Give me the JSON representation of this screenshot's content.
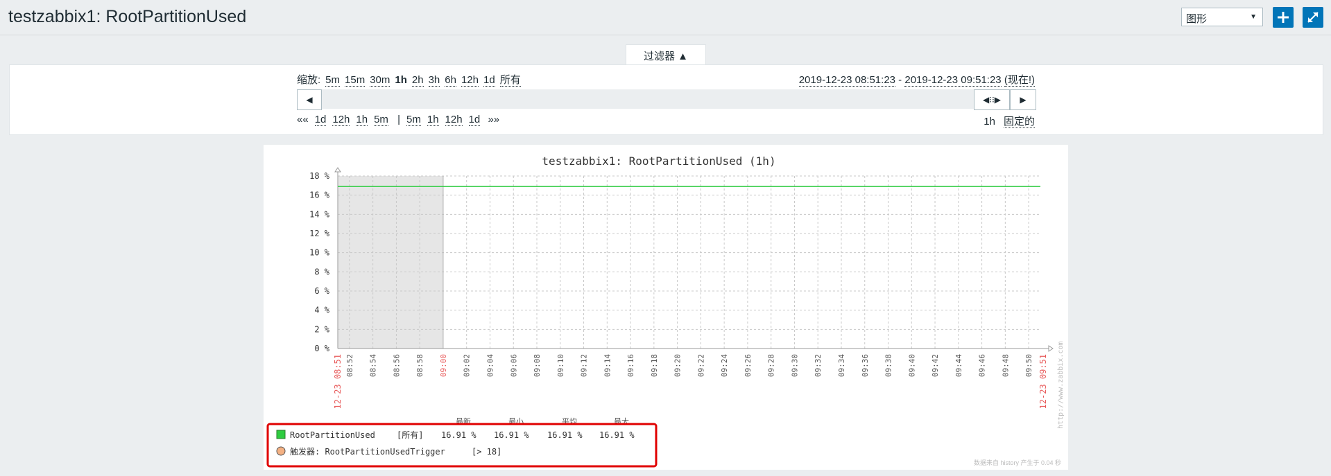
{
  "header": {
    "title": "testzabbix1: RootPartitionUsed",
    "view_select": "图形",
    "add_icon": "plus-icon",
    "fullscreen_icon": "fullscreen-icon"
  },
  "filter": {
    "tab_label": "过滤器",
    "zoom_label": "缩放:",
    "zoom_options": [
      "5m",
      "15m",
      "30m",
      "1h",
      "2h",
      "3h",
      "6h",
      "12h",
      "1d",
      "所有"
    ],
    "zoom_selected": "1h",
    "range_from": "2019-12-23 08:51:23",
    "range_sep": " - ",
    "range_to": "2019-12-23 09:51:23",
    "range_now": "(现在!)",
    "nav_back_prefix": "««",
    "nav_back": [
      "1d",
      "12h",
      "1h",
      "5m"
    ],
    "nav_sep": "|",
    "nav_fwd": [
      "5m",
      "1h",
      "12h",
      "1d"
    ],
    "nav_fwd_suffix": "»»",
    "period": "1h",
    "fixed_label": "固定的"
  },
  "chart_data": {
    "type": "line",
    "title": "testzabbix1: RootPartitionUsed (1h)",
    "ylim": [
      0,
      18
    ],
    "yticks": [
      "0 %",
      "2 %",
      "4 %",
      "6 %",
      "8 %",
      "10 %",
      "12 %",
      "14 %",
      "16 %",
      "18 %"
    ],
    "xticks": [
      "08:52",
      "08:54",
      "08:56",
      "08:58",
      "09:00",
      "09:02",
      "09:04",
      "09:06",
      "09:08",
      "09:10",
      "09:12",
      "09:14",
      "09:16",
      "09:18",
      "09:20",
      "09:22",
      "09:24",
      "09:26",
      "09:28",
      "09:30",
      "09:32",
      "09:34",
      "09:36",
      "09:38",
      "09:40",
      "09:42",
      "09:44",
      "09:46",
      "09:48",
      "09:50"
    ],
    "x_start_label": "12-23 08:51",
    "x_end_label": "12-23 09:51",
    "grid": true,
    "no_data_region": [
      "08:51",
      "09:00"
    ],
    "series": [
      {
        "name": "RootPartitionUsed",
        "color": "#2ecc40",
        "x": [
          "08:51",
          "09:51"
        ],
        "y": [
          16.91,
          16.91
        ]
      }
    ],
    "watermark": "http://www.zabbix.com",
    "footer": "数据来自 history  产生于 0.04 秒"
  },
  "legend": {
    "headers": [
      "最新",
      "最小",
      "平均",
      "最大"
    ],
    "items": [
      {
        "name": "RootPartitionUsed",
        "scope": "[所有]",
        "values": [
          "16.91 %",
          "16.91 %",
          "16.91 %",
          "16.91 %"
        ],
        "color": "#2ecc40"
      },
      {
        "name": "触发器: RootPartitionUsedTrigger",
        "cond": "[> 18]",
        "color": "#f4b183"
      }
    ]
  },
  "colors": {
    "accent": "#0275b8",
    "highlight": "#e00000",
    "axis_red": "#e85c5c"
  }
}
